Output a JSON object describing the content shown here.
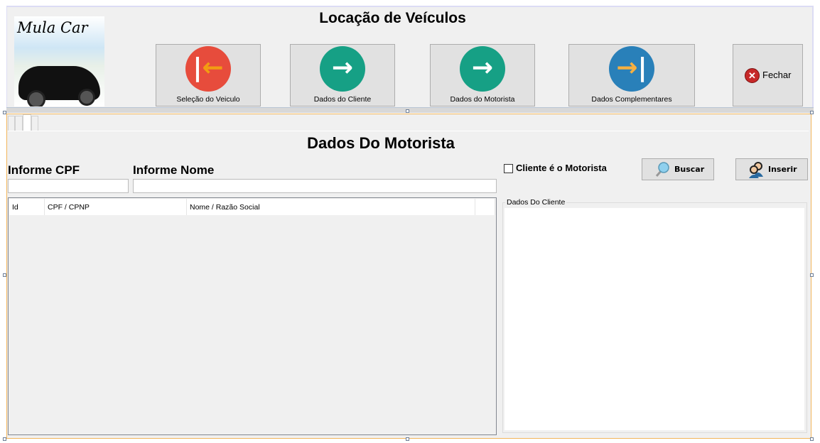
{
  "header": {
    "title": "Locação de Veículos",
    "logo_text": "Mula Car"
  },
  "nav_buttons": [
    {
      "label": "Seleção do Veiculo",
      "icon": "arrow-left-bar-icon",
      "color": "#e74c3c"
    },
    {
      "label": "Dados do Cliente",
      "icon": "arrow-right-icon",
      "color": "#16a085"
    },
    {
      "label": "Dados do Motorista",
      "icon": "arrow-right-icon",
      "color": "#16a085"
    },
    {
      "label": "Dados Complementares",
      "icon": "arrow-right-bar-icon",
      "color": "#2980b9"
    }
  ],
  "close_button": {
    "label": "Fechar",
    "icon": "close-circle-icon"
  },
  "section_title": "Dados Do Motorista",
  "form": {
    "cpf_label": "Informe CPF",
    "cpf_value": "",
    "name_label": "Informe Nome",
    "name_value": "",
    "checkbox_label": "Cliente é o Motorista",
    "checkbox_checked": false,
    "search_label": "Buscar",
    "insert_label": "Inserir"
  },
  "grid": {
    "columns": [
      "Id",
      "CPF / CPNP",
      "Nome / Razão Social",
      ""
    ],
    "rows": []
  },
  "client_group": {
    "label": "Dados Do Cliente"
  }
}
